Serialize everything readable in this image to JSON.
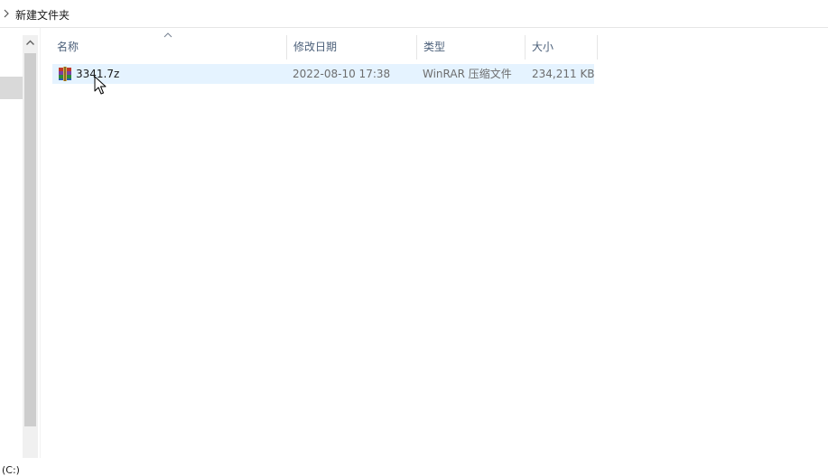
{
  "address": {
    "path": "新建文件夹",
    "chevron_icon": "chevron-right-icon"
  },
  "nav": {
    "drive_label": "(C:)"
  },
  "columns": {
    "name": "名称",
    "date": "修改日期",
    "type": "类型",
    "size": "大小",
    "sorted_by": "name"
  },
  "files": [
    {
      "name": "3341.7z",
      "date": "2022-08-10 17:38",
      "type": "WinRAR 压缩文件",
      "size": "234,211 KB",
      "icon": "winrar-archive-icon",
      "hovered": true
    }
  ],
  "colors": {
    "row_hover": "#e5f3ff",
    "header_text": "#4c607a",
    "cell_muted_text": "#6d6d6d"
  }
}
